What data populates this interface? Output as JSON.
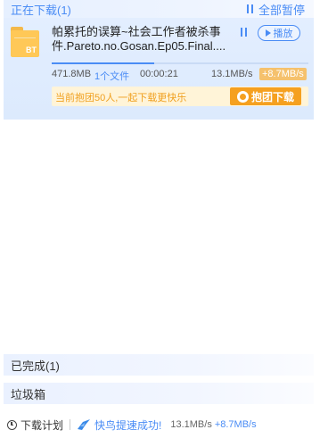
{
  "downloading": {
    "title": "正在下载(1)",
    "pause_all_label": "全部暂停"
  },
  "task": {
    "icon_label": "BT",
    "name": "帕累托的误算~社会工作者被杀事件.Pareto.no.Gosan.Ep05.Final....",
    "play_label": "播放",
    "progress_percent": 40,
    "size": "471.8MB",
    "files": "1个文件",
    "time": "00:00:21",
    "speed": "13.1MB/s",
    "boost": "+8.7MB/s",
    "group_text": "当前抱团50人,一起下载更快乐",
    "group_button": "抱团下载"
  },
  "completed": {
    "label": "已完成(1)"
  },
  "trash": {
    "label": "垃圾箱"
  },
  "footer": {
    "plan_label": "下载计划",
    "boost_message": "快鸟提速成功!",
    "speed": "13.1MB/s",
    "boost": "+8.7MB/s"
  },
  "colors": {
    "accent": "#4a8cf5",
    "boost": "#f5c16d",
    "group": "#f5a020"
  }
}
